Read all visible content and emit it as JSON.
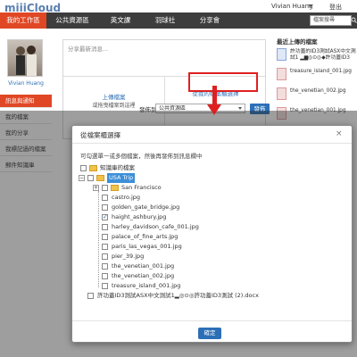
{
  "app": {
    "logo": "miiiCloud",
    "user_name": "Vivian Huang",
    "logout_label": "登出",
    "search_placeholder": "檔案搜尋"
  },
  "nav": {
    "tabs": [
      {
        "label": "我的工作區",
        "active": true
      },
      {
        "label": "公共資源區",
        "active": false
      },
      {
        "label": "英文課",
        "active": false
      },
      {
        "label": "羽球社",
        "active": false
      },
      {
        "label": "分享會",
        "active": false
      }
    ]
  },
  "sidebar": {
    "avatar_name": "Vivian Huang",
    "items": [
      {
        "label": "訊息與通知",
        "active": true
      },
      {
        "label": "我的檔案",
        "active": false
      },
      {
        "label": "我的分享",
        "active": false
      },
      {
        "label": "我標記過的檔案",
        "active": false
      },
      {
        "label": "郵件知識庫",
        "active": false
      }
    ]
  },
  "composer": {
    "placeholder": "分享最新消息...",
    "upload_title": "上傳檔案",
    "upload_sub": "或拖曳檔案到這裡",
    "pick_title": "從我的檔案櫃選擇",
    "post_label": "發佈到:",
    "post_target": "公共資源區",
    "post_button": "發佈"
  },
  "recent": {
    "title": "最近上傳的檔案",
    "items": [
      {
        "type": "doc",
        "text": "許功蓋的ID3測試ASX中文測試1 ▂▆◎⊙◎◆許功蓋ID3"
      },
      {
        "type": "img",
        "text": "treasure_island_001.jpg"
      },
      {
        "type": "img",
        "text": "the_venetian_002.jpg"
      },
      {
        "type": "img",
        "text": "the_venetian_001.jpg"
      },
      {
        "type": "img",
        "text": ""
      }
    ]
  },
  "dialog": {
    "title": "從檔案櫃選擇",
    "close_icon": "×",
    "hint": "可勾選單一或多個檔案，然後再發佈到訊息欄中",
    "ok_button": "確定",
    "tree": [
      {
        "label": "知識庫的檔案",
        "kind": "folder",
        "level": 0,
        "checked": false
      },
      {
        "label": "USA Trip",
        "kind": "folder",
        "level": 0,
        "checked": false,
        "selected": true
      },
      {
        "label": "San Francisco",
        "kind": "folder",
        "level": 1,
        "checked": false
      },
      {
        "label": "castro.jpg",
        "kind": "file",
        "level": 1,
        "checked": false
      },
      {
        "label": "golden_gate_bridge.jpg",
        "kind": "file",
        "level": 1,
        "checked": false
      },
      {
        "label": "haight_ashbury.jpg",
        "kind": "file",
        "level": 1,
        "checked": true
      },
      {
        "label": "harley_davidson_cafe_001.jpg",
        "kind": "file",
        "level": 1,
        "checked": false
      },
      {
        "label": "palace_of_fine_arts.jpg",
        "kind": "file",
        "level": 1,
        "checked": false
      },
      {
        "label": "paris_las_vegas_001.jpg",
        "kind": "file",
        "level": 1,
        "checked": false
      },
      {
        "label": "pier_39.jpg",
        "kind": "file",
        "level": 1,
        "checked": false
      },
      {
        "label": "the_venetian_001.jpg",
        "kind": "file",
        "level": 1,
        "checked": false
      },
      {
        "label": "the_venetian_002.jpg",
        "kind": "file",
        "level": 1,
        "checked": false
      },
      {
        "label": "treasure_island_001.jpg",
        "kind": "file",
        "level": 1,
        "checked": false
      },
      {
        "label": "許功蓋ID3測試ASX中文測試1▂◎⊙◎許功蓋ID3測試 (2).docx",
        "kind": "file",
        "level": 0,
        "checked": false
      }
    ]
  },
  "colors": {
    "accent_red": "#e04825",
    "nav_bg": "#3d3d3d",
    "link_blue": "#2c6fb7",
    "highlight_red": "#e02020"
  }
}
